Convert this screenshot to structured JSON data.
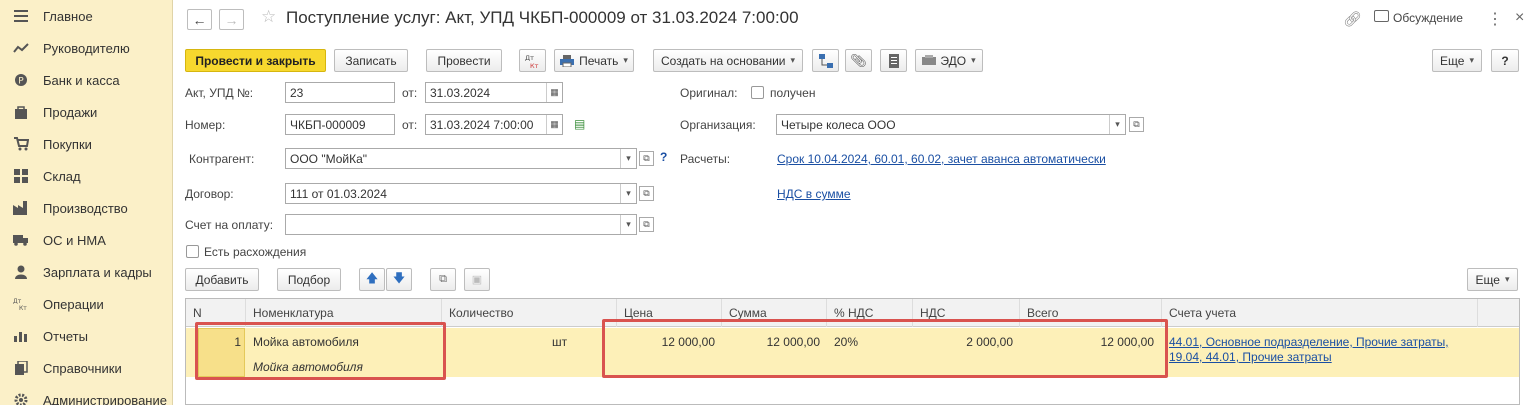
{
  "sidebar": {
    "items": [
      {
        "label": "Главное",
        "icon": "menu-icon"
      },
      {
        "label": "Руководителю",
        "icon": "trend-icon"
      },
      {
        "label": "Банк и касса",
        "icon": "coin-icon"
      },
      {
        "label": "Продажи",
        "icon": "bag-icon"
      },
      {
        "label": "Покупки",
        "icon": "cart-icon"
      },
      {
        "label": "Склад",
        "icon": "warehouse-icon"
      },
      {
        "label": "Производство",
        "icon": "factory-icon"
      },
      {
        "label": "ОС и НМА",
        "icon": "truck-icon"
      },
      {
        "label": "Зарплата и кадры",
        "icon": "person-icon"
      },
      {
        "label": "Операции",
        "icon": "dt-kt-icon"
      },
      {
        "label": "Отчеты",
        "icon": "bar-chart-icon"
      },
      {
        "label": "Справочники",
        "icon": "book-icon"
      },
      {
        "label": "Администрирование",
        "icon": "gear-icon"
      }
    ]
  },
  "header": {
    "title": "Поступление услуг: Акт, УПД ЧКБП-000009 от 31.03.2024 7:00:00",
    "discussion": "Обсуждение"
  },
  "toolbar": {
    "post_close": "Провести и закрыть",
    "save": "Записать",
    "post": "Провести",
    "dtkt": "Дт Кт",
    "print": "Печать",
    "create_based": "Создать на основании",
    "edo": "ЭДО",
    "more": "Еще",
    "help": "?"
  },
  "form": {
    "act_label": "Акт, УПД №:",
    "act_value": "23",
    "from_label": "от:",
    "act_date": "31.03.2024",
    "number_label": "Номер:",
    "number_value": "ЧКБП-000009",
    "number_date": "31.03.2024  7:00:00",
    "original_label": "Оригинал:",
    "received_label": "получен",
    "org_label": "Организация:",
    "org_value": "Четыре колеса ООО",
    "contractor_label": "Контрагент:",
    "contractor_value": "ООО \"МойКа\"",
    "settlements_label": "Расчеты:",
    "settlements_link": "Срок 10.04.2024, 60.01, 60.02, зачет аванса автоматически",
    "contract_label": "Договор:",
    "contract_value": "111 от 01.03.2024",
    "vat_link": "НДС в сумме",
    "invoice_label": "Счет на оплату:",
    "invoice_value": "",
    "discrepancy_label": "Есть расхождения"
  },
  "table_toolbar": {
    "add": "Добавить",
    "select": "Подбор",
    "more": "Еще"
  },
  "table": {
    "columns": [
      "N",
      "Номенклатура",
      "Количество",
      "Цена",
      "Сумма",
      "% НДС",
      "НДС",
      "Всего",
      "Счета учета"
    ],
    "rows": [
      {
        "n": "1",
        "nomenclature": "Мойка автомобиля",
        "nomenclature_sub": "Мойка автомобиля",
        "quantity": "",
        "unit": "шт",
        "price": "12 000,00",
        "sum": "12 000,00",
        "vat_rate": "20%",
        "vat": "2 000,00",
        "total": "12 000,00",
        "accounts_line1": "44.01, Основное подразделение, Прочие затраты,",
        "accounts_line2": "19.04, 44.01, Прочие затраты"
      }
    ]
  },
  "colors": {
    "sidebar_bg": "#fbf0c8",
    "primary_button": "#f7d82e",
    "selected_row": "#fdf0b8",
    "highlight": "#d9534f",
    "link": "#1a4fa3"
  }
}
